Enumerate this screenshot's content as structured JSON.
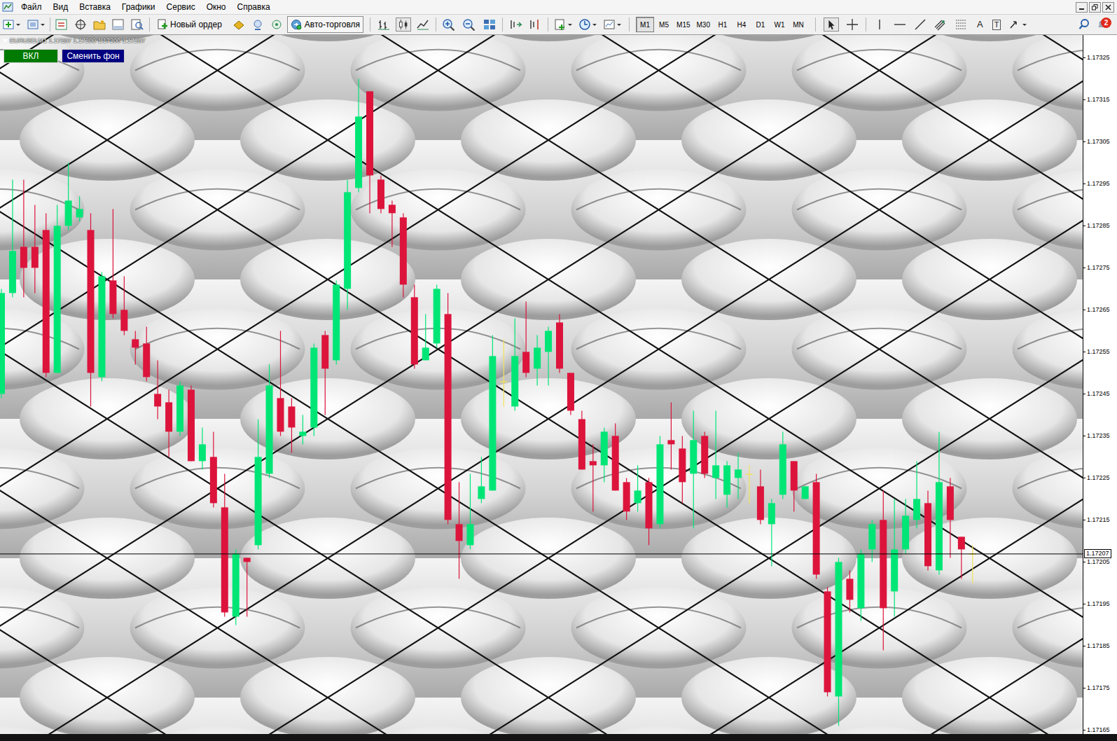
{
  "menu": [
    "Файл",
    "Вид",
    "Вставка",
    "Графики",
    "Сервис",
    "Окно",
    "Справка"
  ],
  "toolbar": {
    "new_order": "Новый ордер",
    "auto_trading": "Авто-торговля",
    "timeframes": [
      {
        "label": "M1",
        "selected": true
      },
      {
        "label": "M5",
        "selected": false
      },
      {
        "label": "M15",
        "selected": false
      },
      {
        "label": "M30",
        "selected": false
      },
      {
        "label": "H1",
        "selected": false
      },
      {
        "label": "H4",
        "selected": false
      },
      {
        "label": "D1",
        "selected": false
      },
      {
        "label": "W1",
        "selected": false
      },
      {
        "label": "MN",
        "selected": false
      }
    ],
    "text_tool": "A",
    "label_tool": "T",
    "notifications": "2"
  },
  "chart": {
    "title": "EURUSD,M1 1.17207 1.17209 1.17200 1.17207",
    "buttons": [
      {
        "label": "ВКЛ",
        "color": "#007a00"
      },
      {
        "label": "Сменить фон",
        "color": "#000080"
      }
    ],
    "price_ticks": [
      "1.17325",
      "1.17315",
      "1.17305",
      "1.17295",
      "1.17285",
      "1.17275",
      "1.17265",
      "1.17255",
      "1.17245",
      "1.17235",
      "1.17225",
      "1.17215",
      "1.17205",
      "1.17195",
      "1.17185",
      "1.17175",
      "1.17165"
    ],
    "current_price": "1.17207",
    "candles": [
      [
        1.17245,
        1.1727,
        1.17244,
        1.17269
      ],
      [
        1.17269,
        1.17296,
        1.17268,
        1.17279
      ],
      [
        1.1728,
        1.17296,
        1.17268,
        1.17275
      ],
      [
        1.1728,
        1.1729,
        1.17269,
        1.17275
      ],
      [
        1.17284,
        1.17288,
        1.17249,
        1.1725
      ],
      [
        1.1725,
        1.1729,
        1.1725,
        1.17285
      ],
      [
        1.17285,
        1.173,
        1.17284,
        1.17291
      ],
      [
        1.17287,
        1.17292,
        1.17286,
        1.17289
      ],
      [
        1.17284,
        1.17288,
        1.17242,
        1.1725
      ],
      [
        1.17249,
        1.17274,
        1.17248,
        1.17273
      ],
      [
        1.17272,
        1.17289,
        1.17263,
        1.17264
      ],
      [
        1.17265,
        1.17273,
        1.17259,
        1.1726
      ],
      [
        1.17258,
        1.1726,
        1.17252,
        1.17256
      ],
      [
        1.17257,
        1.17261,
        1.17248,
        1.17249
      ],
      [
        1.17245,
        1.17253,
        1.17239,
        1.17242
      ],
      [
        1.17243,
        1.17246,
        1.1723,
        1.17236
      ],
      [
        1.17236,
        1.17248,
        1.17235,
        1.17247
      ],
      [
        1.17246,
        1.17247,
        1.17229,
        1.17229
      ],
      [
        1.17229,
        1.17237,
        1.17227,
        1.17233
      ],
      [
        1.1723,
        1.17236,
        1.17218,
        1.17219
      ],
      [
        1.17218,
        1.17226,
        1.17192,
        1.17193
      ],
      [
        1.17192,
        1.17208,
        1.1719,
        1.17207
      ],
      [
        1.17206,
        1.17206,
        1.17192,
        1.17205
      ],
      [
        1.17209,
        1.17239,
        1.17208,
        1.1723
      ],
      [
        1.17226,
        1.17252,
        1.17225,
        1.17247
      ],
      [
        1.17244,
        1.1726,
        1.17235,
        1.17236
      ],
      [
        1.17242,
        1.17244,
        1.17231,
        1.17237
      ],
      [
        1.17235,
        1.1724,
        1.17233,
        1.17236
      ],
      [
        1.17237,
        1.17257,
        1.17235,
        1.17256
      ],
      [
        1.17259,
        1.1726,
        1.1724,
        1.17251
      ],
      [
        1.17253,
        1.17272,
        1.17252,
        1.17271
      ],
      [
        1.1727,
        1.17296,
        1.17265,
        1.17293
      ],
      [
        1.17294,
        1.1732,
        1.17293,
        1.17311
      ],
      [
        1.17317,
        1.17317,
        1.17288,
        1.17297
      ],
      [
        1.17296,
        1.17297,
        1.17288,
        1.17289
      ],
      [
        1.1729,
        1.17291,
        1.1728,
        1.17288
      ],
      [
        1.17287,
        1.17288,
        1.17268,
        1.17271
      ],
      [
        1.17268,
        1.17271,
        1.17251,
        1.17252
      ],
      [
        1.17253,
        1.17264,
        1.17253,
        1.17256
      ],
      [
        1.17257,
        1.17271,
        1.17256,
        1.1727
      ],
      [
        1.17264,
        1.17269,
        1.17214,
        1.17215
      ],
      [
        1.17214,
        1.17224,
        1.17201,
        1.1721
      ],
      [
        1.17209,
        1.17226,
        1.17208,
        1.17214
      ],
      [
        1.1722,
        1.1723,
        1.17219,
        1.17223
      ],
      [
        1.17222,
        1.17259,
        1.17222,
        1.17254
      ],
      [
        1.17248,
        1.17258,
        1.17242,
        1.17248
      ],
      [
        1.17242,
        1.17263,
        1.17241,
        1.17254
      ],
      [
        1.17255,
        1.17267,
        1.17249,
        1.1725
      ],
      [
        1.17251,
        1.17259,
        1.17247,
        1.17256
      ],
      [
        1.17255,
        1.17261,
        1.17247,
        1.1726
      ],
      [
        1.17262,
        1.17264,
        1.1725,
        1.17251
      ],
      [
        1.1725,
        1.1725,
        1.1724,
        1.17241
      ],
      [
        1.17239,
        1.17241,
        1.17227,
        1.17227
      ],
      [
        1.17229,
        1.17233,
        1.17217,
        1.17228
      ],
      [
        1.17228,
        1.17237,
        1.17224,
        1.17236
      ],
      [
        1.17235,
        1.17238,
        1.17222,
        1.17222
      ],
      [
        1.17224,
        1.17225,
        1.17215,
        1.17217
      ],
      [
        1.17219,
        1.17228,
        1.17217,
        1.17222
      ],
      [
        1.17224,
        1.17225,
        1.17209,
        1.17213
      ],
      [
        1.17214,
        1.17235,
        1.17213,
        1.17233
      ],
      [
        1.17234,
        1.17243,
        1.17227,
        1.17233
      ],
      [
        1.17232,
        1.17235,
        1.17219,
        1.17224
      ],
      [
        1.17226,
        1.17241,
        1.17213,
        1.17234
      ],
      [
        1.17235,
        1.17236,
        1.17225,
        1.17226
      ],
      [
        1.17225,
        1.17241,
        1.1722,
        1.17228
      ],
      [
        1.17221,
        1.17229,
        1.17218,
        1.17228
      ],
      [
        1.17225,
        1.17231,
        1.1722,
        1.17227
      ],
      [
        1.17226,
        1.17228,
        1.17219,
        1.17226
      ],
      [
        1.17223,
        1.17227,
        1.17214,
        1.17215
      ],
      [
        1.17214,
        1.1722,
        1.17204,
        1.17219
      ],
      [
        1.17221,
        1.17236,
        1.1722,
        1.17233
      ],
      [
        1.17229,
        1.17229,
        1.17217,
        1.17222
      ],
      [
        1.1722,
        1.17223,
        1.1722,
        1.17223
      ],
      [
        1.17224,
        1.17226,
        1.17201,
        1.17202
      ],
      [
        1.17198,
        1.17199,
        1.17173,
        1.17174
      ],
      [
        1.17173,
        1.17206,
        1.17166,
        1.17205
      ],
      [
        1.17201,
        1.17203,
        1.17193,
        1.17196
      ],
      [
        1.17194,
        1.17208,
        1.17191,
        1.17207
      ],
      [
        1.17208,
        1.17215,
        1.17205,
        1.17214
      ],
      [
        1.17215,
        1.17222,
        1.17184,
        1.17194
      ],
      [
        1.17198,
        1.1722,
        1.17192,
        1.17208
      ],
      [
        1.17208,
        1.1722,
        1.17207,
        1.17216
      ],
      [
        1.17215,
        1.17229,
        1.17213,
        1.1722
      ],
      [
        1.17219,
        1.17222,
        1.17203,
        1.17204
      ],
      [
        1.17203,
        1.17236,
        1.17202,
        1.17224
      ],
      [
        1.17223,
        1.17225,
        1.17206,
        1.17215
      ],
      [
        1.17211,
        1.17211,
        1.17201,
        1.17208
      ],
      [
        1.17207,
        1.17209,
        1.172,
        1.17207
      ]
    ]
  }
}
